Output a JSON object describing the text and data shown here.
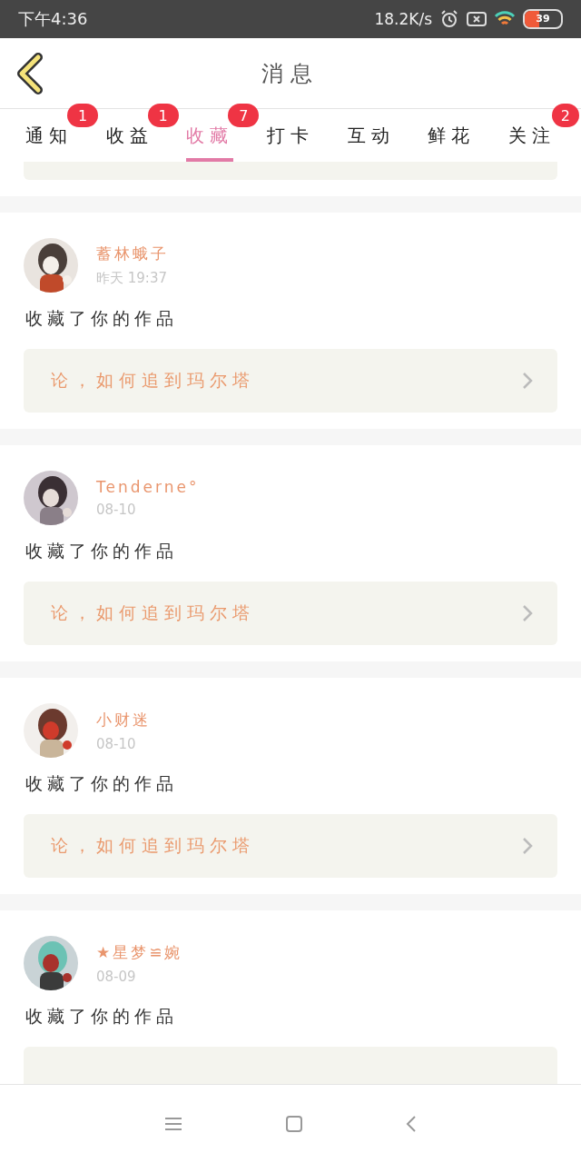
{
  "status_bar": {
    "time": "下午4:36",
    "speed": "18.2K/s",
    "battery": "39"
  },
  "header": {
    "title": "消息"
  },
  "tabs": [
    {
      "label": "通知",
      "badge": "1",
      "selected": false
    },
    {
      "label": "收益",
      "badge": "1",
      "selected": false
    },
    {
      "label": "收藏",
      "badge": "7",
      "selected": true
    },
    {
      "label": "打卡",
      "selected": false
    },
    {
      "label": "互动",
      "selected": false
    },
    {
      "label": "鲜花",
      "selected": false
    },
    {
      "label": "关注",
      "badge": "2",
      "selected": false
    }
  ],
  "messages": [
    {
      "name": "蓄林蛾子",
      "time": "昨天 19:37",
      "action": "收藏了你的作品",
      "work": "论，如何追到玛尔塔"
    },
    {
      "name": "Tenderne°",
      "time": "08-10",
      "action": "收藏了你的作品",
      "work": "论，如何追到玛尔塔"
    },
    {
      "name": "小财迷",
      "time": "08-10",
      "action": "收藏了你的作品",
      "work": "论，如何追到玛尔塔"
    },
    {
      "name": "★星梦≌婉",
      "time": "08-09",
      "action": "收藏了你的作品"
    }
  ]
}
